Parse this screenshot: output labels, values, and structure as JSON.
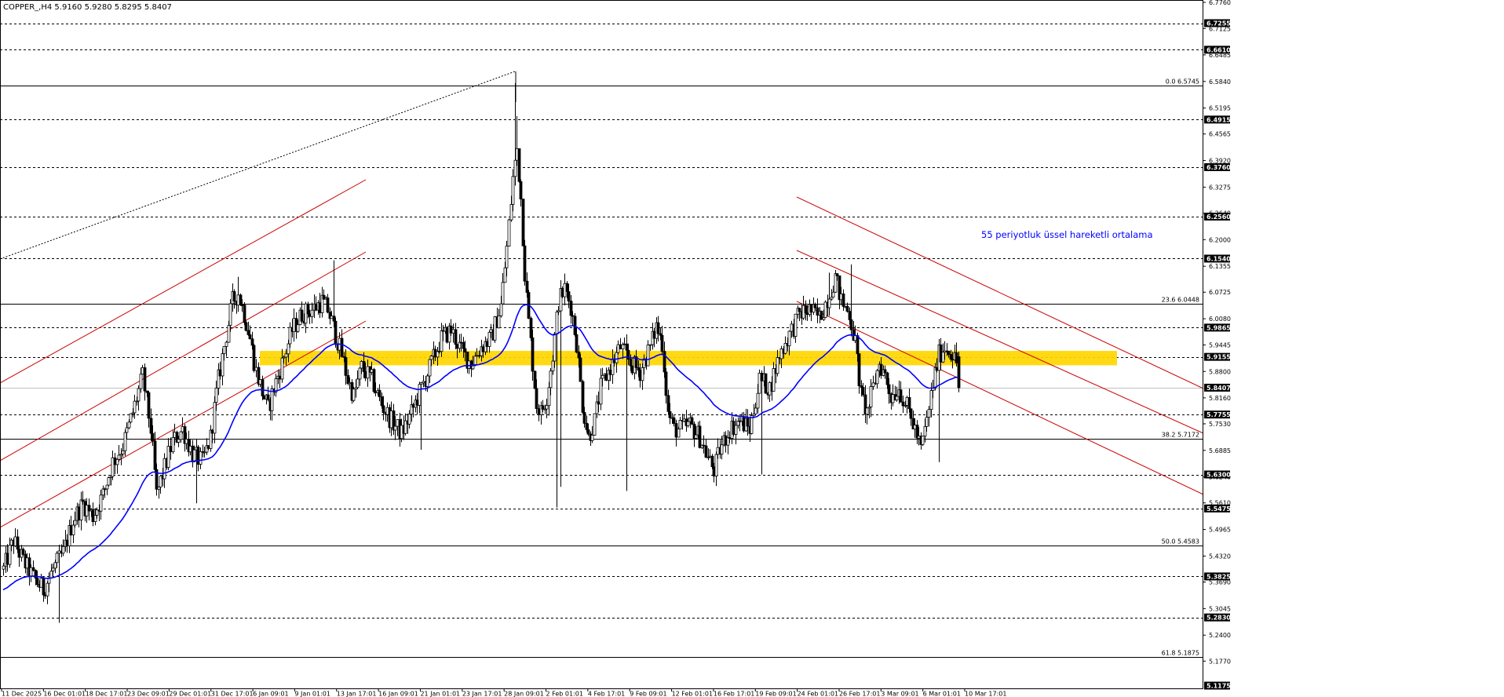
{
  "header": {
    "symbol_line": "COPPER_,H4  5.9160 5.9280 5.8295 5.8407"
  },
  "annotation": {
    "text": "55 periyotluk üssel hareketli ortalama"
  },
  "colors": {
    "background": "#ffffff",
    "candle": "#000000",
    "ema": "#0000ff",
    "resistance_zone": "#ffd700",
    "channel": "#cc0000",
    "annotation": "#0000ff",
    "price_tag": "#000000",
    "grid": "#000000",
    "fib_line": "#000000",
    "current_price_line": "#c0c0c0"
  },
  "chart_data": {
    "type": "candlestick",
    "symbol": "COPPER_",
    "timeframe": "H4",
    "ohlc": {
      "open": 5.916,
      "high": 5.928,
      "low": 5.8295,
      "close": 5.8407
    },
    "ylim": [
      5.1175,
      6.776
    ],
    "y_ticks": [
      "6.7760",
      "6.7125",
      "6.6485",
      "6.5840",
      "6.5195",
      "6.4565",
      "6.3920",
      "6.3275",
      "6.2640",
      "6.2000",
      "6.1355",
      "6.0725",
      "6.0080",
      "5.9445",
      "5.8800",
      "5.8160",
      "5.7530",
      "5.6885",
      "5.6240",
      "5.5610",
      "5.4965",
      "5.4320",
      "5.3690",
      "5.3045",
      "5.2400",
      "5.1770"
    ],
    "price_tags": [
      "6.7255",
      "6.6610",
      "6.4915",
      "6.3760",
      "6.2560",
      "6.1540",
      "5.9865",
      "5.9155",
      "5.8407",
      "5.7755",
      "5.6300",
      "5.5475",
      "5.3825",
      "5.2830",
      "5.1175"
    ],
    "dashed_levels": [
      "6.7255",
      "6.6610",
      "6.4915",
      "6.3760",
      "6.2560",
      "6.1540",
      "5.9865",
      "5.9155",
      "5.7755",
      "5.6300",
      "5.5475",
      "5.3825",
      "5.2830"
    ],
    "fibonacci": [
      {
        "label": "0.0 6.5745",
        "price": 6.5745
      },
      {
        "label": "23.6 6.0448",
        "price": 6.0448
      },
      {
        "label": "38.2 5.7172",
        "price": 5.7172
      },
      {
        "label": "50.0 5.4583",
        "price": 5.4583
      },
      {
        "label": "61.8 5.1875",
        "price": 5.1875
      }
    ],
    "current_price": 5.8407,
    "resistance_zone": [
      5.895,
      5.93
    ],
    "x_labels": [
      "11 Dec 2025",
      "16 Dec 01:01",
      "18 Dec 17:01",
      "23 Dec 09:01",
      "29 Dec 01:01",
      "31 Dec 17:01",
      "6 Jan 09:01",
      "9 Jan 01:01",
      "13 Jan 17:01",
      "16 Jan 09:01",
      "21 Jan 01:01",
      "23 Jan 17:01",
      "28 Jan 09:01",
      "2 Feb 01:01",
      "4 Feb 17:01",
      "9 Feb 09:01",
      "12 Feb 01:01",
      "16 Feb 17:01",
      "19 Feb 09:01",
      "24 Feb 01:01",
      "26 Feb 17:01",
      "3 Mar 09:01",
      "6 Mar 01:01",
      "10 Mar 17:01"
    ],
    "close_path": [
      [
        0,
        5.4
      ],
      [
        5,
        5.47
      ],
      [
        10,
        5.42
      ],
      [
        15,
        5.38
      ],
      [
        20,
        5.35
      ],
      [
        25,
        5.4
      ],
      [
        30,
        5.44
      ],
      [
        35,
        5.52
      ],
      [
        40,
        5.56
      ],
      [
        45,
        5.53
      ],
      [
        50,
        5.58
      ],
      [
        55,
        5.66
      ],
      [
        60,
        5.7
      ],
      [
        65,
        5.78
      ],
      [
        70,
        5.87
      ],
      [
        74,
        5.74
      ],
      [
        77,
        5.58
      ],
      [
        80,
        5.63
      ],
      [
        85,
        5.71
      ],
      [
        90,
        5.74
      ],
      [
        95,
        5.68
      ],
      [
        100,
        5.66
      ],
      [
        104,
        5.72
      ],
      [
        108,
        5.86
      ],
      [
        112,
        5.97
      ],
      [
        115,
        6.05
      ],
      [
        118,
        6.07
      ],
      [
        121,
        6.02
      ],
      [
        124,
        5.96
      ],
      [
        127,
        5.88
      ],
      [
        130,
        5.83
      ],
      [
        133,
        5.79
      ],
      [
        136,
        5.84
      ],
      [
        140,
        5.9
      ],
      [
        145,
        5.98
      ],
      [
        150,
        6.02
      ],
      [
        155,
        6.03
      ],
      [
        160,
        6.05
      ],
      [
        163,
        6.03
      ],
      [
        167,
        5.97
      ],
      [
        170,
        5.92
      ],
      [
        173,
        5.86
      ],
      [
        176,
        5.82
      ],
      [
        180,
        5.89
      ],
      [
        185,
        5.86
      ],
      [
        190,
        5.8
      ],
      [
        195,
        5.76
      ],
      [
        200,
        5.73
      ],
      [
        205,
        5.78
      ],
      [
        210,
        5.84
      ],
      [
        215,
        5.9
      ],
      [
        220,
        5.96
      ],
      [
        225,
        5.98
      ],
      [
        230,
        5.93
      ],
      [
        235,
        5.9
      ],
      [
        240,
        5.94
      ],
      [
        245,
        5.96
      ],
      [
        250,
        6.04
      ],
      [
        253,
        6.18
      ],
      [
        256,
        6.35
      ],
      [
        258,
        6.42
      ],
      [
        260,
        6.3
      ],
      [
        262,
        6.12
      ],
      [
        264,
        6.0
      ],
      [
        266,
        5.9
      ],
      [
        268,
        5.8
      ],
      [
        270,
        5.78
      ],
      [
        273,
        5.82
      ],
      [
        276,
        5.92
      ],
      [
        279,
        6.05
      ],
      [
        282,
        6.08
      ],
      [
        285,
        6.04
      ],
      [
        288,
        5.95
      ],
      [
        291,
        5.8
      ],
      [
        294,
        5.72
      ],
      [
        297,
        5.76
      ],
      [
        300,
        5.84
      ],
      [
        305,
        5.89
      ],
      [
        310,
        5.94
      ],
      [
        315,
        5.9
      ],
      [
        320,
        5.88
      ],
      [
        325,
        5.94
      ],
      [
        328,
        5.99
      ],
      [
        331,
        5.95
      ],
      [
        334,
        5.78
      ],
      [
        337,
        5.74
      ],
      [
        340,
        5.74
      ],
      [
        345,
        5.75
      ],
      [
        350,
        5.72
      ],
      [
        354,
        5.67
      ],
      [
        357,
        5.64
      ],
      [
        360,
        5.69
      ],
      [
        365,
        5.74
      ],
      [
        370,
        5.76
      ],
      [
        375,
        5.74
      ],
      [
        380,
        5.86
      ],
      [
        385,
        5.84
      ],
      [
        390,
        5.92
      ],
      [
        395,
        5.97
      ],
      [
        400,
        6.02
      ],
      [
        405,
        6.03
      ],
      [
        410,
        6.01
      ],
      [
        415,
        6.07
      ],
      [
        418,
        6.11
      ],
      [
        421,
        6.05
      ],
      [
        425,
        6.02
      ],
      [
        428,
        5.95
      ],
      [
        431,
        5.82
      ],
      [
        434,
        5.78
      ],
      [
        437,
        5.84
      ],
      [
        440,
        5.9
      ],
      [
        443,
        5.87
      ],
      [
        446,
        5.82
      ],
      [
        450,
        5.84
      ],
      [
        455,
        5.78
      ],
      [
        458,
        5.74
      ],
      [
        461,
        5.69
      ],
      [
        464,
        5.76
      ],
      [
        467,
        5.85
      ],
      [
        470,
        5.92
      ],
      [
        473,
        5.94
      ],
      [
        476,
        5.93
      ],
      [
        479,
        5.9
      ],
      [
        480,
        5.8407
      ]
    ],
    "ema_period": 55
  }
}
